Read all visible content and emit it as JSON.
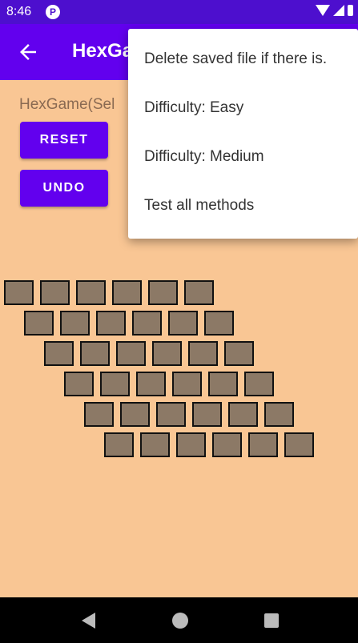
{
  "status_bar": {
    "time": "8:46",
    "notification_badge": "P",
    "icons": [
      "wifi-icon",
      "signal-icon",
      "battery-icon"
    ]
  },
  "app_bar": {
    "title": "HexGame",
    "back_icon": "arrow-left-icon",
    "color": "#6200ee"
  },
  "main": {
    "subtitle": "HexGame(Sel",
    "reset_label": "RESET",
    "undo_label": "UNDO"
  },
  "board": {
    "rows": 6,
    "cols": 6,
    "cell_color": "#8c7966"
  },
  "menu": {
    "items": [
      "Delete saved file if there is.",
      "Difficulty: Easy",
      "Difficulty: Medium",
      "Test all methods"
    ]
  },
  "nav_bar": {
    "buttons": [
      "nav-back-icon",
      "nav-home-icon",
      "nav-recents-icon"
    ]
  },
  "colors": {
    "background": "#f9c694",
    "status_bar": "#4d0fce",
    "accent": "#6200ee"
  }
}
